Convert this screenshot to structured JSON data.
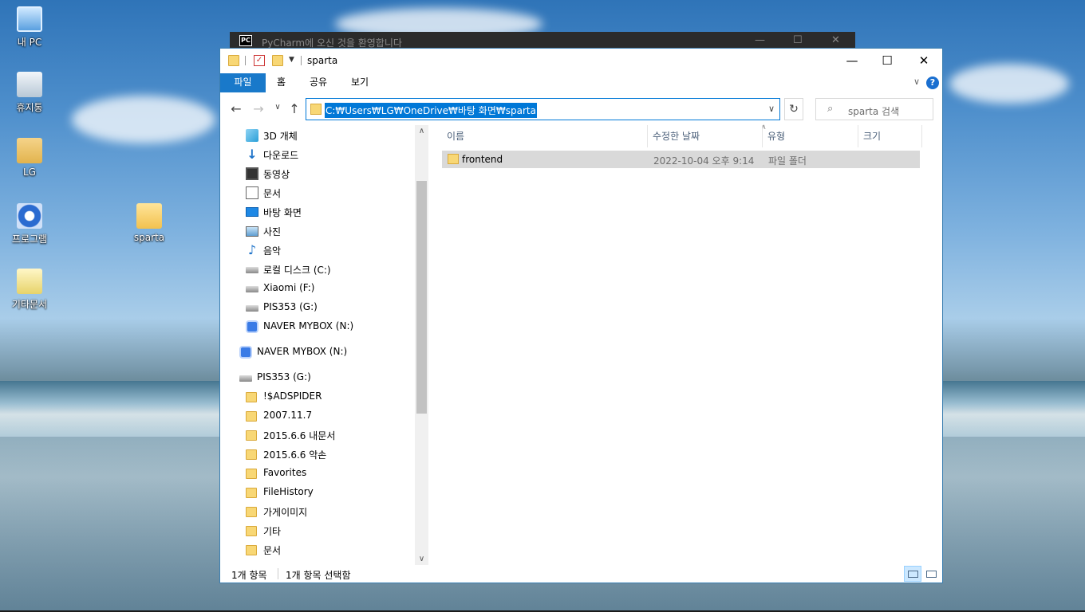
{
  "desktop": {
    "icons": [
      {
        "label": "내 PC",
        "icon": "pc-icon"
      },
      {
        "label": "휴지통",
        "icon": "recycle-bin-icon"
      },
      {
        "label": "LG",
        "icon": "user-folder-icon"
      },
      {
        "label": "프로그램",
        "icon": "program-icon"
      },
      {
        "label": "sparta",
        "icon": "folder-icon"
      },
      {
        "label": "기타문서",
        "icon": "documents-icon"
      }
    ]
  },
  "background_window": {
    "title": "PyCharm에 오신 것을 환영합니다",
    "logo": "PC"
  },
  "explorer": {
    "title": "sparta",
    "caption": {
      "minimize": "—",
      "maximize": "☐",
      "close": "✕"
    },
    "ribbon_tabs": [
      "파일",
      "홈",
      "공유",
      "보기"
    ],
    "help": "?",
    "address": "C:₩Users₩LG₩OneDrive₩바탕 화면₩sparta",
    "search_placeholder": "sparta 검색",
    "nav_items": [
      {
        "label": "3D 개체",
        "icon": "3d-objects-icon"
      },
      {
        "label": "다운로드",
        "icon": "download-icon"
      },
      {
        "label": "동영상",
        "icon": "video-icon"
      },
      {
        "label": "문서",
        "icon": "document-icon"
      },
      {
        "label": "바탕 화면",
        "icon": "desktop-icon"
      },
      {
        "label": "사진",
        "icon": "pictures-icon"
      },
      {
        "label": "음악",
        "icon": "music-icon"
      },
      {
        "label": "로컬 디스크 (C:)",
        "icon": "local-disk-icon"
      },
      {
        "label": "Xiaomi (F:)",
        "icon": "drive-icon"
      },
      {
        "label": "PIS353 (G:)",
        "icon": "drive-icon"
      },
      {
        "label": "NAVER MYBOX (N:)",
        "icon": "naver-mybox-icon"
      },
      {
        "label": "NAVER MYBOX (N:)",
        "icon": "naver-mybox-icon"
      },
      {
        "label": "PIS353 (G:)",
        "icon": "drive-icon"
      },
      {
        "label": "!$ADSPIDER",
        "icon": "folder-icon"
      },
      {
        "label": "2007.11.7",
        "icon": "folder-icon"
      },
      {
        "label": "2015.6.6 내문서",
        "icon": "folder-icon"
      },
      {
        "label": "2015.6.6 악손",
        "icon": "folder-icon"
      },
      {
        "label": "Favorites",
        "icon": "folder-icon"
      },
      {
        "label": "FileHistory",
        "icon": "folder-icon"
      },
      {
        "label": "가게이미지",
        "icon": "folder-icon"
      },
      {
        "label": "기타",
        "icon": "folder-icon"
      },
      {
        "label": "문서",
        "icon": "folder-icon"
      }
    ],
    "columns": [
      "이름",
      "수정한 날짜",
      "유형",
      "크기"
    ],
    "files": [
      {
        "name": "frontend",
        "modified": "2022-10-04 오후 9:14",
        "type": "파일 폴더",
        "size": ""
      }
    ],
    "status": {
      "count": "1개 항목",
      "selected": "1개 항목 선택함"
    }
  }
}
